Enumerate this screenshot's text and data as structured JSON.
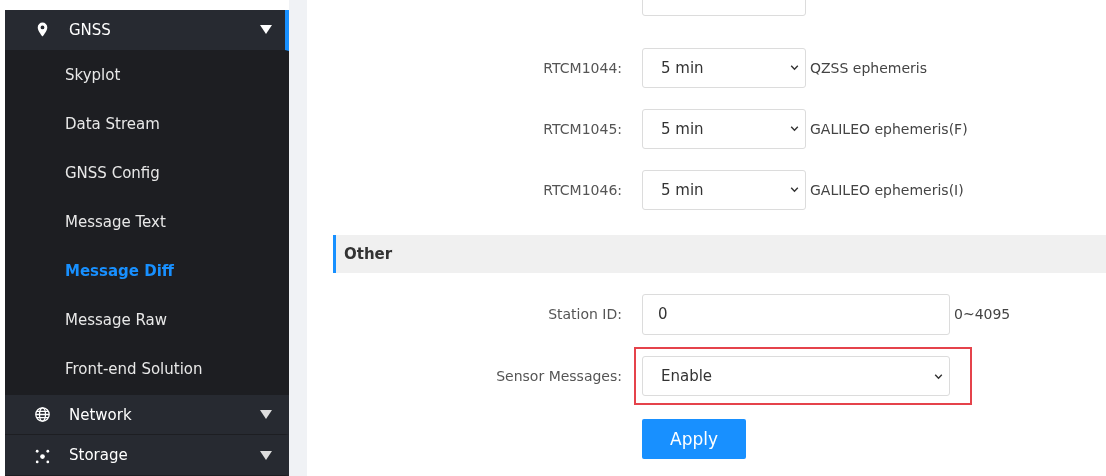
{
  "sidebar": {
    "groups": [
      {
        "label": "GNSS",
        "expanded": true,
        "active": true,
        "children": [
          {
            "label": "Skyplot",
            "selected": false
          },
          {
            "label": "Data Stream",
            "selected": false
          },
          {
            "label": "GNSS Config",
            "selected": false
          },
          {
            "label": "Message Text",
            "selected": false
          },
          {
            "label": "Message Diff",
            "selected": true
          },
          {
            "label": "Message Raw",
            "selected": false
          },
          {
            "label": "Front-end Solution",
            "selected": false
          }
        ]
      },
      {
        "label": "Network",
        "expanded": false,
        "active": false
      },
      {
        "label": "Storage",
        "expanded": false,
        "active": false
      }
    ]
  },
  "rtcm_rows": [
    {
      "label": "RTCM1044:",
      "value": "5 min",
      "description": "QZSS ephemeris"
    },
    {
      "label": "RTCM1045:",
      "value": "5 min",
      "description": "GALILEO ephemeris(F)"
    },
    {
      "label": "RTCM1046:",
      "value": "5 min",
      "description": "GALILEO ephemeris(I)"
    }
  ],
  "other_section": {
    "title": "Other",
    "fields": [
      {
        "kind": "input",
        "label": "Station ID:",
        "value": "0",
        "hint": "0~4095",
        "highlighted": false
      },
      {
        "kind": "select",
        "label": "Sensor Messages:",
        "value": "Enable",
        "highlighted": true
      }
    ]
  },
  "apply_button": "Apply"
}
